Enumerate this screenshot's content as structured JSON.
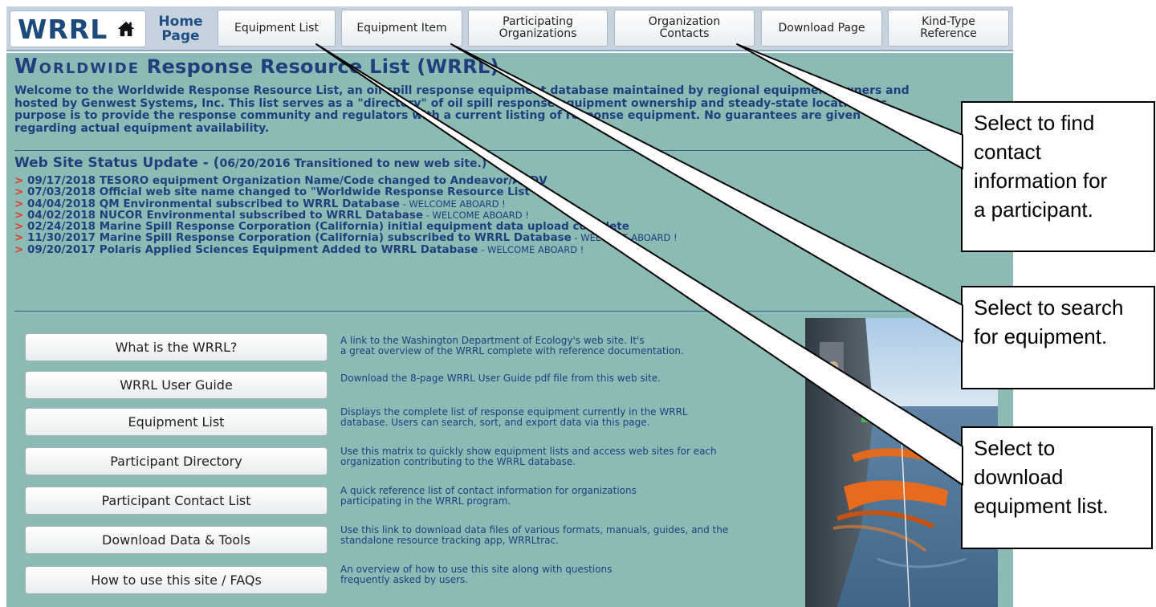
{
  "nav": {
    "logo_text": "WRRL",
    "home_label": "Home\nPage",
    "items": [
      {
        "label": "Equipment List"
      },
      {
        "label": "Equipment Item"
      },
      {
        "label": "Participating\nOrganizations"
      },
      {
        "label": "Organization\nContacts"
      },
      {
        "label": "Download Page"
      },
      {
        "label": "Kind-Type\nReference"
      }
    ]
  },
  "header": {
    "title_caps": "Worldwide",
    "title_rest": "Response Resource List (WRRL)",
    "intro": "Welcome to the Worldwide Response Resource List, an oil spill response equipment database maintained by regional equipment owners and\nhosted by Genwest Systems, Inc.  This list serves as a \"directory\" of oil spill response equipment ownership and steady-state location.  Its\npurpose is to provide the response community and regulators with a current listing of response equipment.  No guarantees are given\nregarding actual equipment availability."
  },
  "status": {
    "title": "Web Site Status Update - (",
    "note": "06/20/2016  Transitioned to new web site.",
    "close": ")",
    "marker": ">",
    "items": [
      {
        "text": " 09/17/2018  TESORO equipment Organization Name/Code changed to Andeavor/ANDV",
        "welcome": ""
      },
      {
        "text": " 07/03/2018  Official web site name changed to \"Worldwide Response Resource List\"",
        "welcome": ""
      },
      {
        "text": " 04/04/2018  QM Environmental subscribed to WRRL Database",
        "welcome": "  - WELCOME ABOARD !"
      },
      {
        "text": " 04/02/2018  NUCOR Environmental subscribed to WRRL Database",
        "welcome": "  - WELCOME ABOARD !"
      },
      {
        "text": " 02/24/2018  Marine Spill Response Corporation (California) initial equipment data upload complete",
        "welcome": ""
      },
      {
        "text": " 11/30/2017  Marine Spill Response Corporation (California) subscribed to WRRL Database",
        "welcome": "  - WELCOME ABOARD !"
      },
      {
        "text": " 09/20/2017  Polaris Applied Sciences Equipment Added to WRRL Database",
        "welcome": "  - WELCOME ABOARD !"
      }
    ]
  },
  "links": [
    {
      "label": "What is the WRRL?",
      "desc": "A link to the Washington Department of Ecology's web site.  It's\na great overview of the WRRL complete with reference documentation."
    },
    {
      "label": "WRRL User Guide",
      "desc": "Download the 8-page WRRL User Guide pdf file from this web site."
    },
    {
      "label": "Equipment List",
      "desc": "Displays the complete list of response equipment currently in the WRRL\ndatabase.  Users can search, sort, and export data via this page."
    },
    {
      "label": "Participant Directory",
      "desc": "Use this matrix to quickly show equipment lists and access web sites for each\norganization contributing to the WRRL database."
    },
    {
      "label": "Participant Contact List",
      "desc": "A quick reference list of contact information for organizations\nparticipating in the WRRL program."
    },
    {
      "label": "Download Data & Tools",
      "desc": "Use this link to download data files of various formats, manuals, guides, and the\nstandalone resource tracking app, WRRLtrac."
    },
    {
      "label": "How to use this site / FAQs",
      "desc": "An overview of how to use this site along with questions\nfrequently asked by users."
    }
  ],
  "callouts": [
    {
      "text": "Select to find\ncontact\ninformation for\na participant."
    },
    {
      "text": "Select to search\nfor equipment."
    },
    {
      "text": "Select to\ndownload\nequipment list."
    }
  ],
  "colors": {
    "panel": "#8bbbb4",
    "nav": "#c6d3df",
    "heading": "#1f3f7d",
    "marker": "#e03a2a"
  }
}
